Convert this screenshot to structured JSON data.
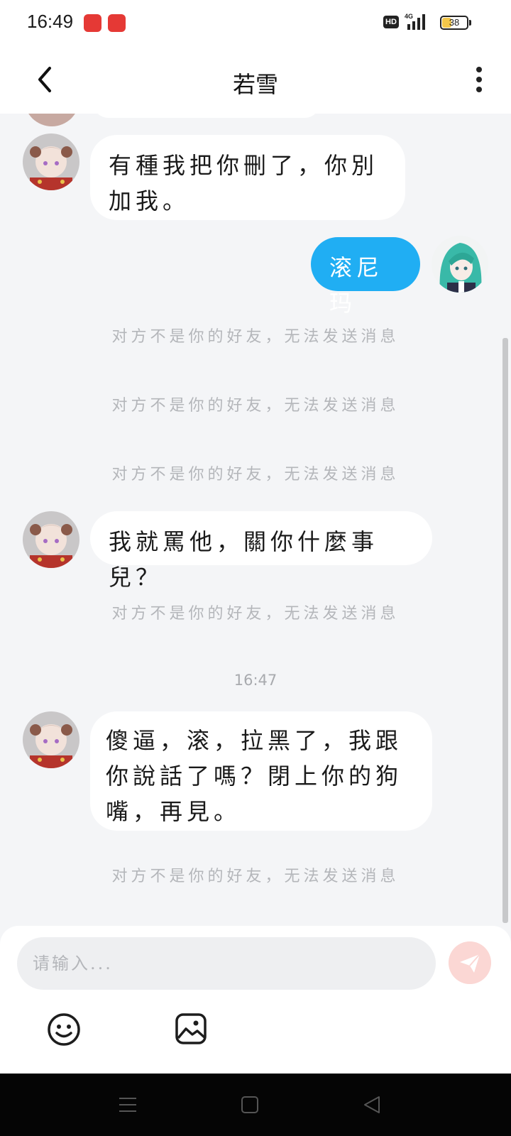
{
  "status_bar": {
    "time": "16:49",
    "network": "HD",
    "signal_label": "4G",
    "battery": "38",
    "battery_level": 0.38,
    "battery_color": "#f3c74a",
    "notification_icons": [
      "video-app-icon",
      "shopping-app-icon"
    ]
  },
  "header": {
    "title": "若雪",
    "back_icon": "chevron-left-icon",
    "menu_icon": "more-vertical-icon"
  },
  "messages": [
    {
      "side": "left",
      "text": "有種我把你刪了，你別加我。"
    },
    {
      "side": "right",
      "text": "滚尼玛"
    },
    {
      "system": "对方不是你的好友，无法发送消息"
    },
    {
      "system": "对方不是你的好友，无法发送消息"
    },
    {
      "system": "对方不是你的好友，无法发送消息"
    },
    {
      "side": "left",
      "text": "我就罵他，關你什麼事兒？"
    },
    {
      "system": "对方不是你的好友，无法发送消息"
    },
    {
      "timestamp": "16:47"
    },
    {
      "side": "left",
      "text": "傻逼，滚，拉黑了，我跟你說話了嗎？閉上你的狗嘴，再見。"
    },
    {
      "system": "对方不是你的好友，无法发送消息"
    }
  ],
  "composer": {
    "placeholder": "请输入...",
    "send_icon": "send-icon",
    "emoji_icon": "emoji-icon",
    "image_icon": "image-icon"
  },
  "nav_bar": {
    "icons": [
      "menu-icon",
      "home-icon",
      "back-icon"
    ]
  },
  "colors": {
    "my_bubble": "#20aef3",
    "their_bubble": "#ffffff",
    "background": "#f4f5f7",
    "system_text": "#b4b6ba",
    "send_button": "#fbd7d4"
  }
}
